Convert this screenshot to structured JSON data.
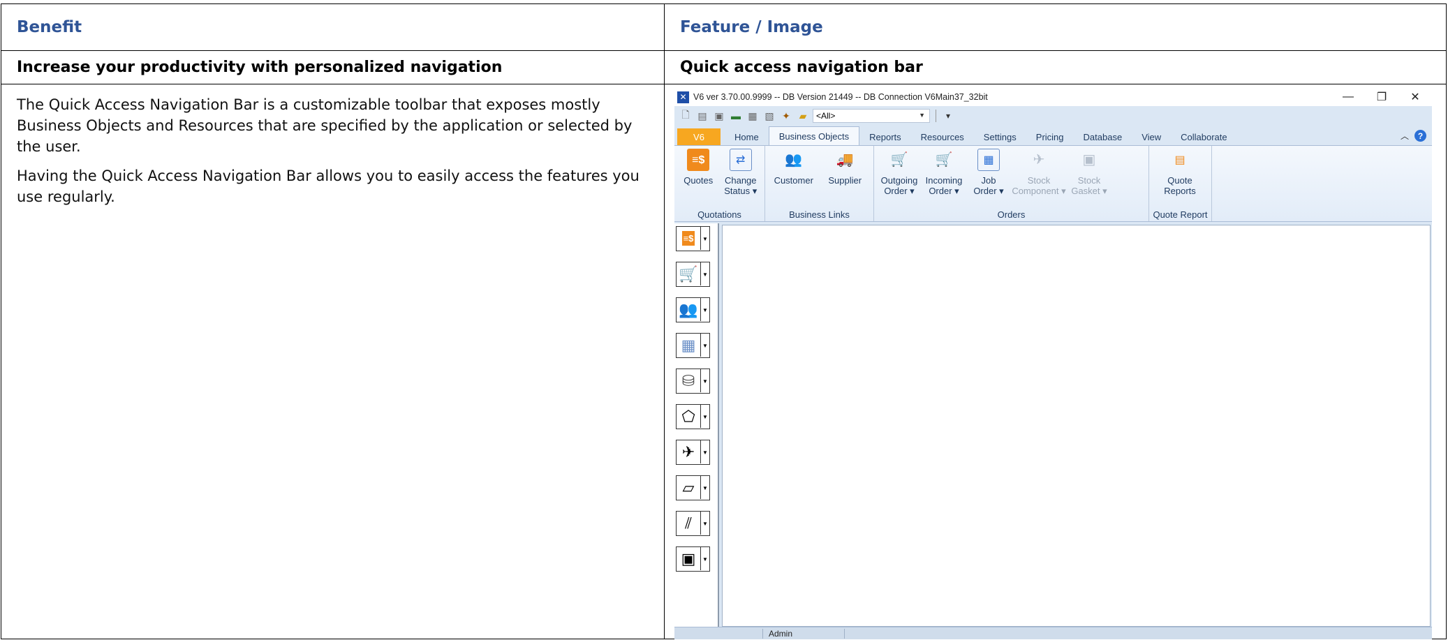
{
  "table": {
    "header_benefit": "Benefit",
    "header_feature": "Feature / Image",
    "row_benefit": "Increase your productivity with personalized navigation",
    "row_feature": "Quick access navigation bar",
    "paragraph1": "The Quick Access Navigation Bar is a customizable toolbar that exposes mostly Business Objects and Resources that are specified by the application or selected by the user.",
    "paragraph2": "Having the Quick Access Navigation Bar allows you to easily access the features you use regularly."
  },
  "app": {
    "title": "V6 ver 3.70.00.9999 -- DB Version 21449 -- DB Connection V6Main37_32bit",
    "qat_select": "<All>",
    "tabs": [
      "V6",
      "Home",
      "Business Objects",
      "Reports",
      "Resources",
      "Settings",
      "Pricing",
      "Database",
      "View",
      "Collaborate"
    ],
    "active_tab": "Business Objects",
    "groups": {
      "quotations": "Quotations",
      "business_links": "Business Links",
      "orders": "Orders",
      "quote_report": "Quote Report"
    },
    "buttons": {
      "quotes": "Quotes",
      "change_status_1": "Change",
      "change_status_2": "Status ▾",
      "customer": "Customer",
      "supplier": "Supplier",
      "outgoing_1": "Outgoing",
      "outgoing_2": "Order ▾",
      "incoming_1": "Incoming",
      "incoming_2": "Order ▾",
      "job_1": "Job",
      "job_2": "Order ▾",
      "stock_comp_1": "Stock",
      "stock_comp_2": "Component ▾",
      "stock_gasket_1": "Stock",
      "stock_gasket_2": "Gasket ▾",
      "quote_reports_1": "Quote",
      "quote_reports_2": "Reports"
    },
    "status_user": "Admin",
    "colors": {
      "file_tab": "#f7a720",
      "ribbon_bg": "#dbe7f4",
      "header_text": "#2F5496"
    }
  }
}
